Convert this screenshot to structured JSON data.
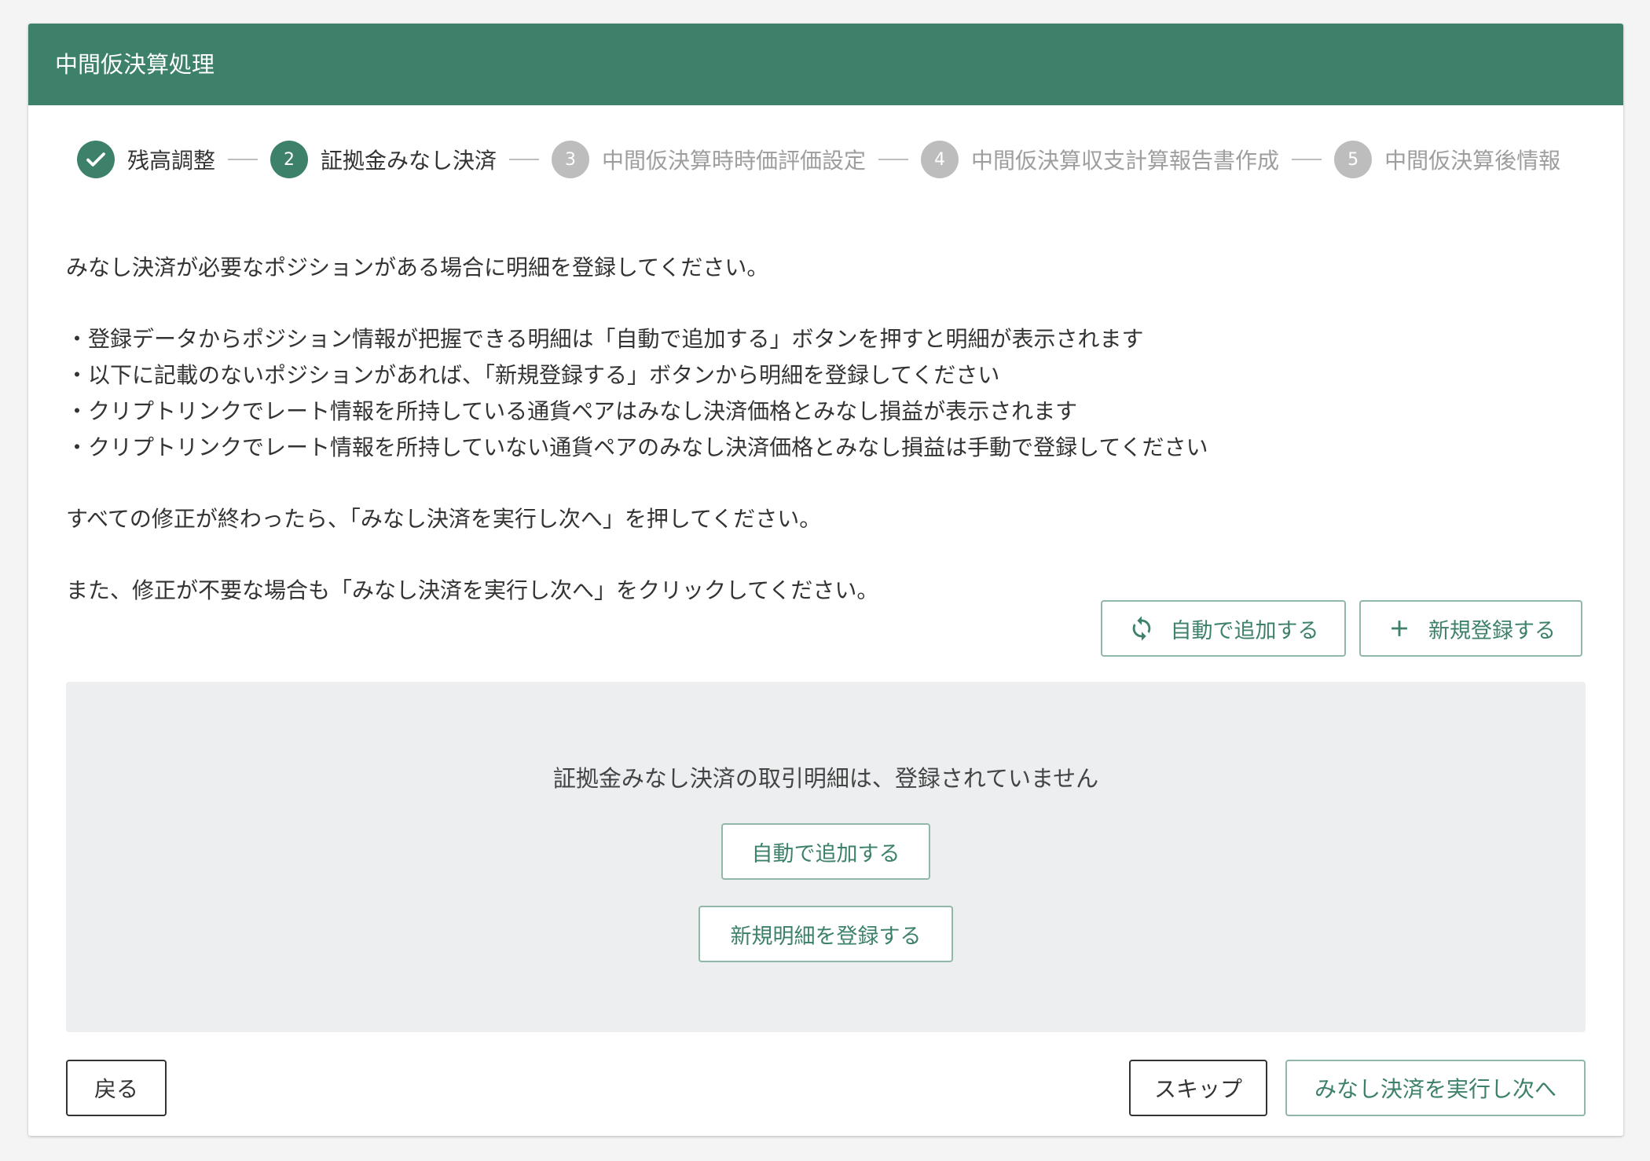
{
  "header": {
    "title": "中間仮決算処理"
  },
  "stepper": {
    "steps": [
      {
        "number": "",
        "label": "残高調整",
        "state": "done"
      },
      {
        "number": "2",
        "label": "証拠金みなし決済",
        "state": "active"
      },
      {
        "number": "3",
        "label": "中間仮決算時時価評価設定",
        "state": "pending"
      },
      {
        "number": "4",
        "label": "中間仮決算収支計算報告書作成",
        "state": "pending"
      },
      {
        "number": "5",
        "label": "中間仮決算後情報",
        "state": "pending"
      }
    ]
  },
  "instructions": {
    "intro": "みなし決済が必要なポジションがある場合に明細を登録してください。",
    "bullets": [
      "・登録データからポジション情報が把握できる明細は「自動で追加する」ボタンを押すと明細が表示されます",
      "・以下に記載のないポジションがあれば、「新規登録する」ボタンから明細を登録してください",
      "・クリプトリンクでレート情報を所持している通貨ペアはみなし決済価格とみなし損益が表示されます",
      "・クリプトリンクでレート情報を所持していない通貨ペアのみなし決済価格とみなし損益は手動で登録してください"
    ],
    "after_edit": "すべての修正が終わったら、「みなし決済を実行し次へ」を押してください。",
    "no_edit": "また、修正が不要な場合も「みなし決済を実行し次へ」をクリックしてください。"
  },
  "actions": {
    "auto_add_label": "自動で追加する",
    "auto_add_icon": "sync-icon",
    "new_register_label": "新規登録する",
    "new_register_icon": "plus-icon"
  },
  "empty_state": {
    "message": "証拠金みなし決済の取引明細は、登録されていません",
    "auto_add_label": "自動で追加する",
    "new_detail_label": "新規明細を登録する"
  },
  "footer": {
    "back_label": "戻る",
    "skip_label": "スキップ",
    "next_label": "みなし決済を実行し次へ"
  },
  "colors": {
    "primary": "#3d816a",
    "pending": "#bdbdbd",
    "panel": "#eceeef"
  }
}
